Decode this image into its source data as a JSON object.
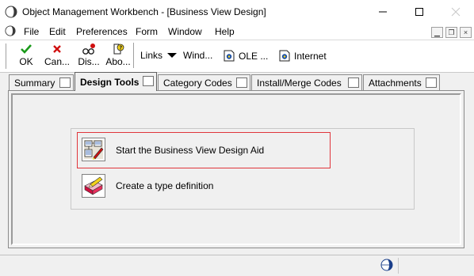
{
  "window": {
    "title": "Object Management Workbench - [Business View Design]"
  },
  "menu": {
    "items": [
      "File",
      "Edit",
      "Preferences",
      "Form",
      "Window",
      "Help"
    ]
  },
  "toolbar": {
    "buttons": [
      {
        "label": "OK",
        "icon": "checkmark-icon",
        "color": "#1a9a1a"
      },
      {
        "label": "Can...",
        "icon": "x-icon",
        "color": "#d01010"
      },
      {
        "label": "Dis...",
        "icon": "display-icon"
      },
      {
        "label": "Abo...",
        "icon": "about-icon"
      }
    ],
    "links": [
      {
        "label": "Links",
        "icon": "none"
      },
      {
        "label": "Wind...",
        "icon": "dropdown-arrow-icon"
      },
      {
        "label": "OLE ...",
        "icon": "ole-icon"
      },
      {
        "label": "Internet",
        "icon": "internet-icon"
      }
    ]
  },
  "tabs": [
    {
      "label": "Summary",
      "active": false
    },
    {
      "label": "Design Tools",
      "active": true
    },
    {
      "label": "Category Codes",
      "active": false
    },
    {
      "label": "Install/Merge Codes",
      "active": false
    },
    {
      "label": "Attachments",
      "active": false
    }
  ],
  "actions": [
    {
      "label": "Start the Business View Design Aid",
      "icon": "design-aid-icon",
      "highlighted": true
    },
    {
      "label": "Create a type definition",
      "icon": "type-definition-icon",
      "highlighted": false
    }
  ],
  "colors": {
    "highlight": "#e0353b",
    "ok_green": "#1a9a1a",
    "cancel_red": "#d01010"
  }
}
